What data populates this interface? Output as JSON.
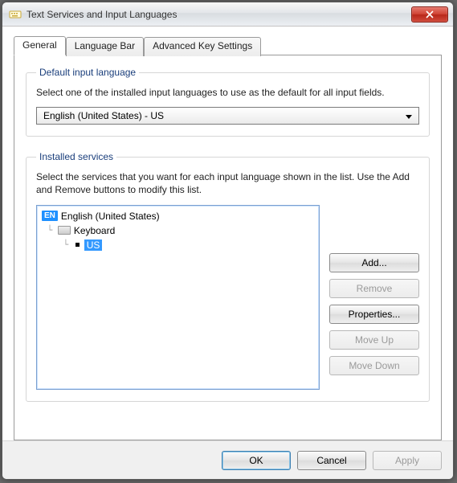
{
  "window": {
    "title": "Text Services and Input Languages"
  },
  "tabs": {
    "general": "General",
    "languageBar": "Language Bar",
    "advanced": "Advanced Key Settings"
  },
  "defaultLang": {
    "legend": "Default input language",
    "desc": "Select one of the installed input languages to use as the default for all input fields.",
    "selected": "English (United States) - US"
  },
  "installed": {
    "legend": "Installed services",
    "desc": "Select the services that you want for each input language shown in the list. Use the Add and Remove buttons to modify this list.",
    "langBadge": "EN",
    "langName": "English (United States)",
    "category": "Keyboard",
    "layout": "US"
  },
  "buttons": {
    "add": "Add...",
    "remove": "Remove",
    "properties": "Properties...",
    "moveUp": "Move Up",
    "moveDown": "Move Down",
    "ok": "OK",
    "cancel": "Cancel",
    "apply": "Apply"
  }
}
